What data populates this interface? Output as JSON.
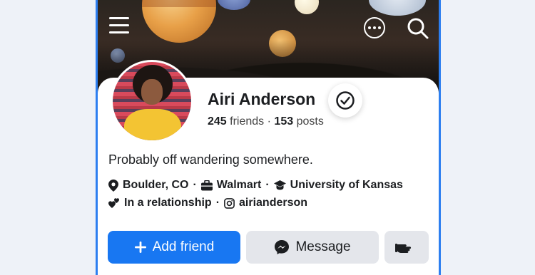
{
  "profile": {
    "name": "Airi Anderson",
    "friends_count": "245",
    "friends_label": "friends",
    "separator": "·",
    "posts_count": "153",
    "posts_label": "posts",
    "bio": "Probably off wandering somewhere.",
    "location": "Boulder, CO",
    "workplace": "Walmart",
    "education": "University of Kansas",
    "relationship": "In a relationship",
    "instagram": "airianderson"
  },
  "actions": {
    "add_friend_label": "Add friend",
    "message_label": "Message"
  },
  "icons": {
    "menu": "hamburger-menu-icon",
    "more": "more-options-icon",
    "search": "search-icon",
    "verified": "verified-check-icon",
    "location": "map-pin-icon",
    "work": "briefcase-icon",
    "education": "graduation-cap-icon",
    "relationship": "hearts-icon",
    "instagram": "instagram-icon",
    "add": "plus-icon",
    "messenger": "messenger-icon",
    "poke": "poke-hand-icon"
  },
  "colors": {
    "accent": "#1877f2",
    "frame": "#2d7ff0",
    "text": "#1c1e21",
    "secondary_button": "#e4e6eb"
  }
}
